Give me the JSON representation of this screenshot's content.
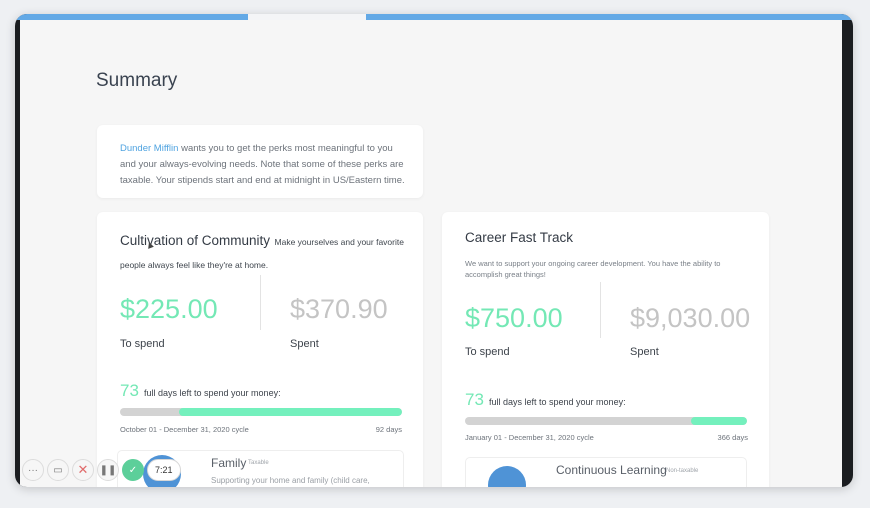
{
  "page": {
    "title": "Summary"
  },
  "intro": {
    "company": "Dunder Mifflin",
    "text": " wants you to get the perks most meaningful to you and your always-evolving needs. Note that some of these perks are taxable. Your stipends start and end at midnight in US/Eastern time."
  },
  "stipends": [
    {
      "title": "Cultivation of Community",
      "subtitle": "Make yourselves and your favorite people always feel like they're at home.",
      "to_spend": "$225.00",
      "to_spend_label": "To spend",
      "spent": "$370.90",
      "spent_label": "Spent",
      "days_left": "73",
      "days_text": "full days left to spend your money:",
      "progress_elapsed_fraction": 0.79,
      "cycle": "October 01 - December 31, 2020 cycle",
      "cycle_days": "92 days",
      "perk": {
        "title": "Family",
        "tag": "Taxable",
        "desc": "Supporting your home and family (child care,"
      }
    },
    {
      "title": "Career Fast Track",
      "subtitle": "We want to support your ongoing career development. You have the ability to accomplish great things!",
      "to_spend": "$750.00",
      "to_spend_label": "To spend",
      "spent": "$9,030.00",
      "spent_label": "Spent",
      "days_left": "73",
      "days_text": "full days left to spend your money:",
      "progress_elapsed_fraction": 0.2,
      "cycle": "January 01 - December 31, 2020 cycle",
      "cycle_days": "366 days",
      "perk": {
        "title": "Continuous Learning",
        "tag": "Non-taxable",
        "desc": ""
      }
    }
  ],
  "toolbar": {
    "more": "···",
    "camera": "▭",
    "close": "✕",
    "pause": "❚❚",
    "check": "✓",
    "time": "7:21"
  },
  "colors": {
    "accent_green": "#74e8b5",
    "accent_blue": "#4fa3e0",
    "topbar": "#63a9e6"
  },
  "icons": [
    "more-icon",
    "camera-icon",
    "close-icon",
    "pause-icon",
    "check-icon"
  ]
}
